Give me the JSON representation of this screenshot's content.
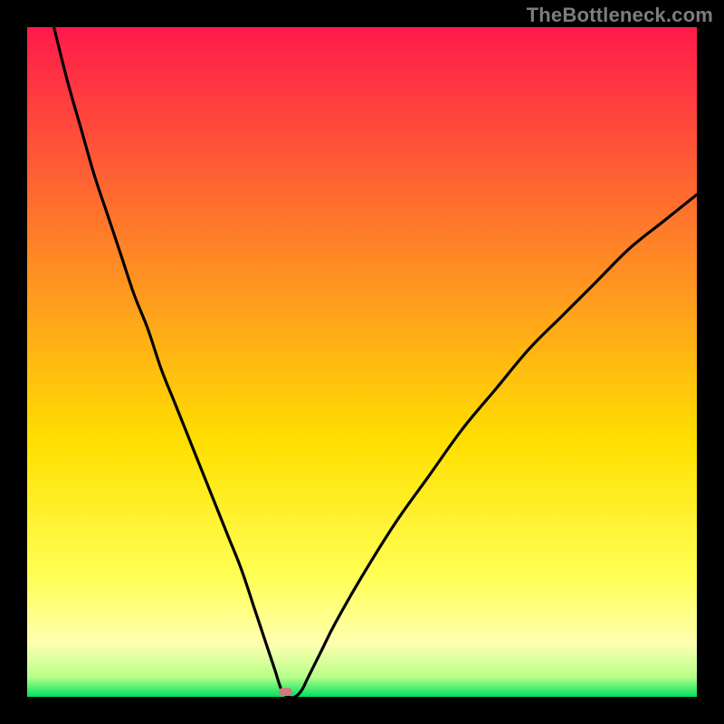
{
  "watermark": {
    "text": "TheBottleneck.com"
  },
  "colors": {
    "background": "#000000",
    "gradient_top": "#ff1a4b",
    "gradient_mid1": "#ff7a2a",
    "gradient_mid2": "#ffd400",
    "gradient_low": "#ffff66",
    "gradient_pale": "#ffffb0",
    "gradient_green": "#00e060",
    "curve": "#000000",
    "marker": "#cd7d7d"
  },
  "chart_data": {
    "type": "line",
    "title": "",
    "xlabel": "",
    "ylabel": "",
    "xlim": [
      0,
      100
    ],
    "ylim": [
      0,
      100
    ],
    "grid": false,
    "legend": false,
    "description": "Bottleneck curve over a vertical red-to-green heat gradient. Y represents mismatch percentage (100 = red/bad, 0 = green/good). Minimum of the curve at x≈38, y≈0.",
    "gradient_stops": [
      {
        "pct": 0,
        "color": "#ff1a4b"
      },
      {
        "pct": 40,
        "color": "#ff9a1f"
      },
      {
        "pct": 62,
        "color": "#ffe000"
      },
      {
        "pct": 82,
        "color": "#ffff55"
      },
      {
        "pct": 92,
        "color": "#ffffb0"
      },
      {
        "pct": 97,
        "color": "#b8ff8a"
      },
      {
        "pct": 100,
        "color": "#00e060"
      }
    ],
    "series": [
      {
        "name": "bottleneck-curve",
        "x": [
          4,
          6,
          8,
          10,
          12,
          14,
          16,
          18,
          20,
          22,
          24,
          26,
          28,
          30,
          32,
          34,
          35,
          36,
          37,
          38,
          39,
          40,
          41,
          42,
          44,
          46,
          50,
          55,
          60,
          65,
          70,
          75,
          80,
          85,
          90,
          95,
          100
        ],
        "y": [
          100,
          92,
          85,
          78,
          72,
          66,
          60,
          55,
          49,
          44,
          39,
          34,
          29,
          24,
          19,
          13,
          10,
          7,
          4,
          1,
          0,
          0,
          1,
          3,
          7,
          11,
          18,
          26,
          33,
          40,
          46,
          52,
          57,
          62,
          67,
          71,
          75
        ]
      }
    ],
    "marker": {
      "x": 38.5,
      "y": 0.5,
      "name": "optimal-point"
    }
  }
}
